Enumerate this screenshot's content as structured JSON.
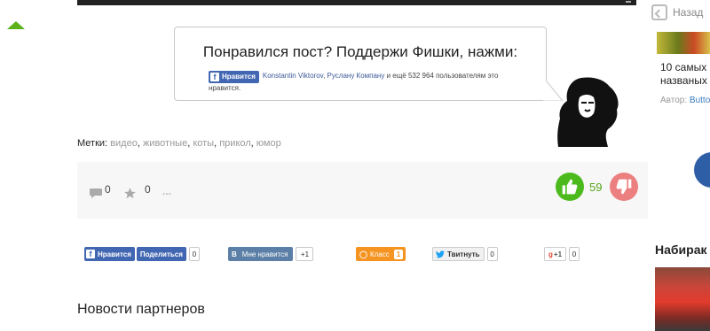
{
  "post": {
    "support_title": "Понравился пост? Поддержи Фишки, нажми:",
    "fb_like": {
      "button_label": "Нравится",
      "friend1": "Konstantin Viktorov",
      "separator": ", ",
      "friend2": "Руслану Компану",
      "suffix": " и ещё 532 964 пользователям это нравится."
    },
    "tags": {
      "label": "Метки",
      "items": [
        "видео",
        "животные",
        "коты",
        "прикол",
        "юмор"
      ]
    },
    "stats": {
      "comments": "0",
      "favorites": "0",
      "more": "...",
      "rating": "59"
    },
    "share": {
      "fb_like": "Нравится",
      "fb_share": "Поделиться",
      "fb_count": "0",
      "vk_label": "Мне нравится",
      "vk_count": "+1",
      "ok_label": "Класс",
      "ok_count": "1",
      "tw_label": "Твитнуть",
      "tw_count": "0",
      "gplus_label": "+1",
      "gplus_count": "0"
    },
    "partners_title": "Новости партнеров"
  },
  "sidebar": {
    "back_label": "Назад",
    "article_title_line1": "10 самых",
    "article_title_line2": "названых",
    "author_label": "Автор:",
    "author_name": "Butto",
    "section_title": "Набирак"
  },
  "colors": {
    "like_green": "#4cba1c",
    "dislike_pink": "#ec7f80",
    "facebook_blue": "#4267b2",
    "vk_blue": "#5b7fa6",
    "ok_orange": "#f59421",
    "accent_green": "#5cb21a"
  }
}
